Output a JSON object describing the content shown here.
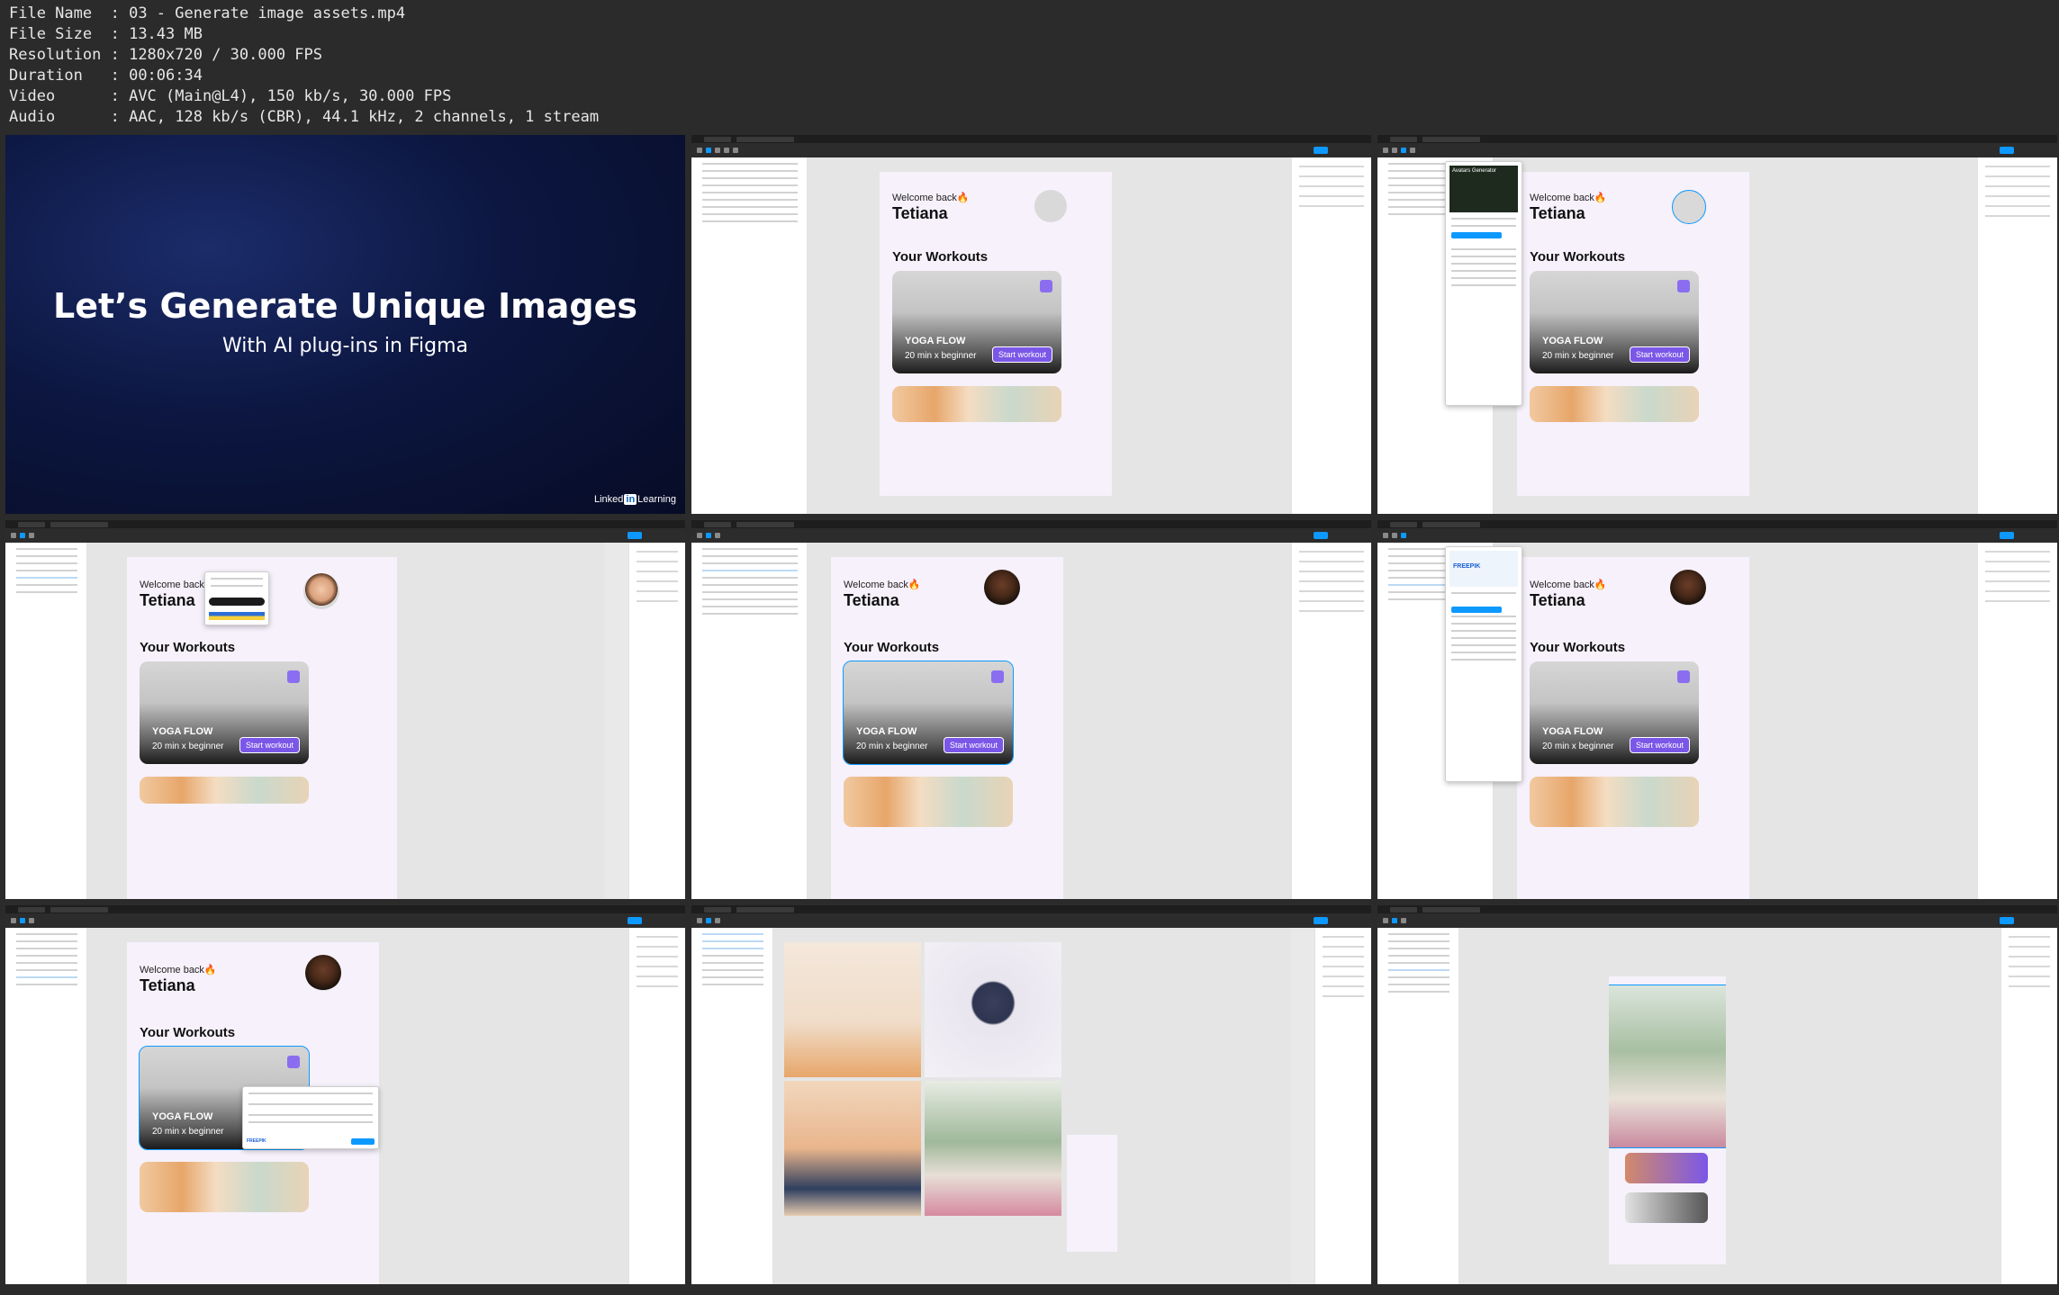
{
  "file_info": [
    {
      "label": "File Name",
      "value": "03 - Generate image assets.mp4"
    },
    {
      "label": "File Size",
      "value": "13.43 MB"
    },
    {
      "label": "Resolution",
      "value": "1280x720 / 30.000 FPS"
    },
    {
      "label": "Duration",
      "value": "00:06:34"
    },
    {
      "label": "Video",
      "value": "AVC (Main@L4), 150 kb/s, 30.000 FPS"
    },
    {
      "label": "Audio",
      "value": "AAC, 128 kb/s (CBR), 44.1 kHz, 2 channels, 1 stream"
    }
  ],
  "intro": {
    "title": "Let’s Generate Unique Images",
    "subtitle": "With AI plug-ins in Figma",
    "brand_text": "Linked",
    "brand_badge": "in",
    "brand_suffix": "Learning"
  },
  "app_screen": {
    "welcome": "Welcome back🔥",
    "name": "Tetiana",
    "section": "Your Workouts",
    "card_title": "YOGA FLOW",
    "card_subtitle": "20 min x beginner",
    "card_button": "Start workout"
  },
  "plugin_names": {
    "avatars": "Avatars Generator",
    "freepik": "FREEPIK"
  },
  "colors": {
    "figma_blue": "#0d99ff",
    "accent_purple": "#7b57e8",
    "screen_bg": "#f6f1fb"
  }
}
